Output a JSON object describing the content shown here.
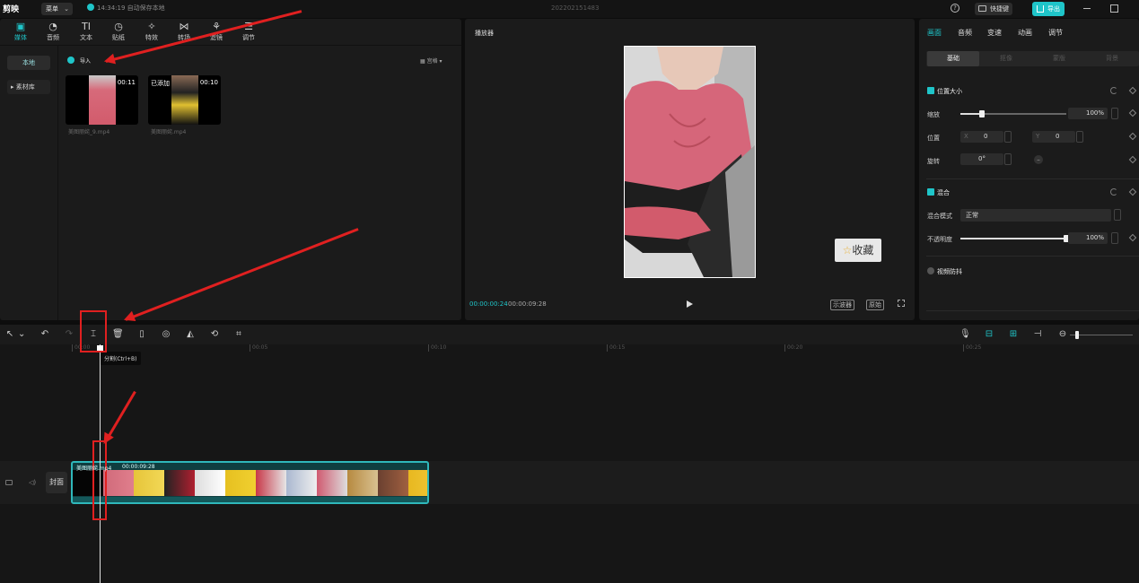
{
  "titlebar": {
    "app_name": "剪映",
    "menu_label": "菜单",
    "autosave": "14:34:19 自动保存本地",
    "project_name": "202202151483",
    "shortcut_label": "快捷键",
    "export_label": "导出"
  },
  "media_panel": {
    "tabs": [
      {
        "label": "媒体",
        "icon": "media-icon"
      },
      {
        "label": "音频",
        "icon": "audio-icon"
      },
      {
        "label": "文本",
        "icon": "text-icon"
      },
      {
        "label": "贴纸",
        "icon": "sticker-icon"
      },
      {
        "label": "特效",
        "icon": "effects-icon"
      },
      {
        "label": "转场",
        "icon": "transition-icon"
      },
      {
        "label": "滤镜",
        "icon": "filter-icon"
      },
      {
        "label": "调节",
        "icon": "adjust-icon"
      }
    ],
    "side_local": "本地",
    "side_library": "素材库",
    "import_label": "导入",
    "view_label": "宫格",
    "items": [
      {
        "duration": "00:11",
        "added": "",
        "name": "美图丽姹_9.mp4"
      },
      {
        "duration": "00:10",
        "added": "已添加",
        "name": "美图丽姹.mp4"
      }
    ]
  },
  "player": {
    "title": "播放器",
    "current_time": "00:00:00:24",
    "total_time": "00:00:09:28",
    "scope_label": "示波器",
    "ratio_label": "原始",
    "fav_label": "收藏"
  },
  "inspector": {
    "tabs": [
      "画面",
      "音频",
      "变速",
      "动画",
      "调节"
    ],
    "subtabs": [
      "基础",
      "抠像",
      "蒙版",
      "背景"
    ],
    "pos_size_title": "位置大小",
    "scale_label": "缩放",
    "scale_value": "100%",
    "scale_fraction": 0.2,
    "position_label": "位置",
    "x_label": "X",
    "x_value": "0",
    "y_label": "Y",
    "y_value": "0",
    "rotate_label": "旋转",
    "rotate_value": "0°",
    "blend_title": "混合",
    "blend_mode_label": "混合模式",
    "blend_mode_value": "正常",
    "opacity_label": "不透明度",
    "opacity_value": "100%",
    "opacity_fraction": 1.0,
    "stabilize_title": "视频防抖"
  },
  "timeline": {
    "ruler": [
      "00:00",
      "00:05",
      "00:10",
      "00:15",
      "00:20",
      "00:25"
    ],
    "tooltip": "分割(Ctrl+B)",
    "cover_label": "封面",
    "clip_name": "美图丽姹.mp4",
    "clip_duration": "00:00:09:28"
  },
  "colors": {
    "accent": "#1fc5c9",
    "annotation": "#e02020"
  }
}
